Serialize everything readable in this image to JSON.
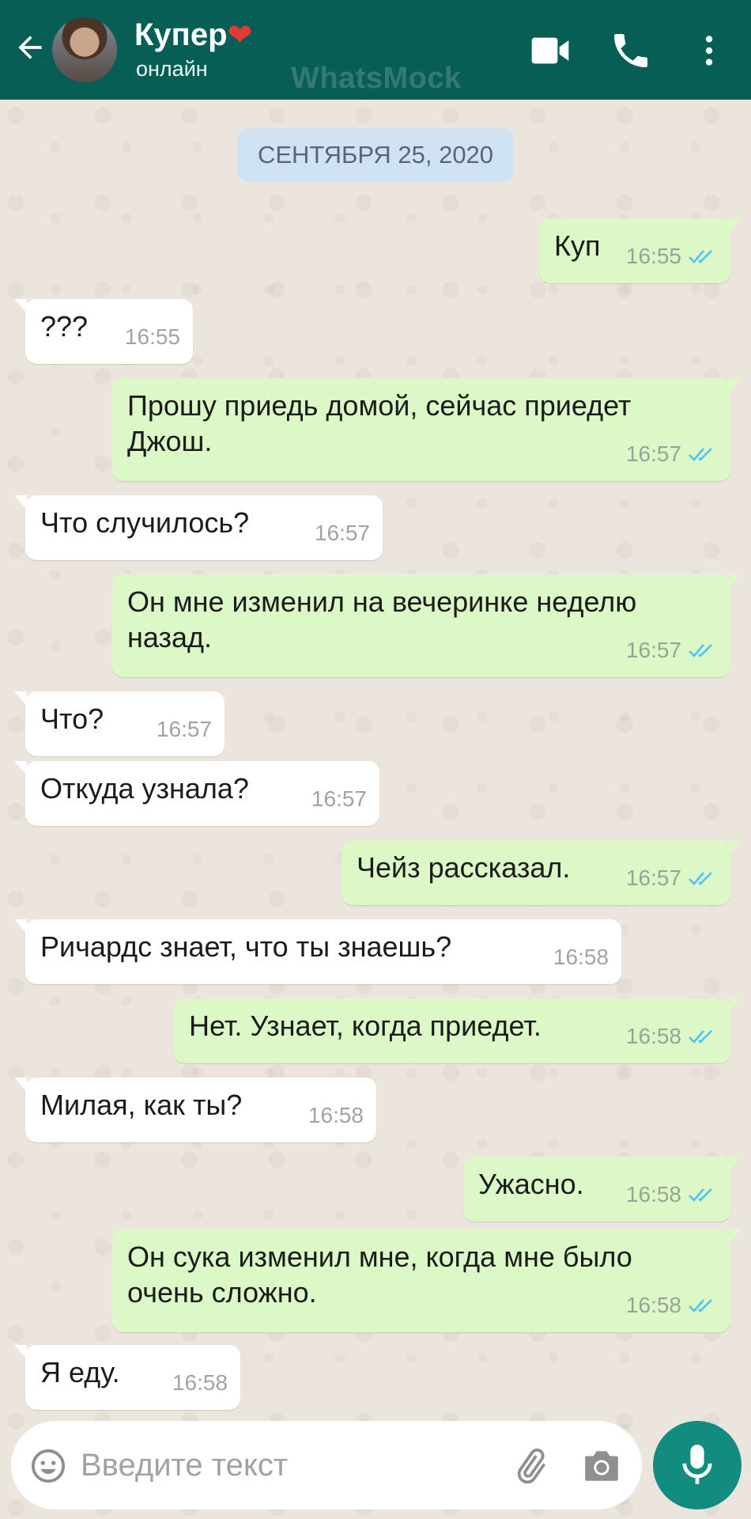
{
  "header": {
    "contact_name": "Купер",
    "contact_status": "онлайн",
    "watermark": "WhatsMock",
    "heart": "❤",
    "icons": [
      "back-arrow-icon",
      "video-call-icon",
      "phone-icon",
      "more-vertical-icon"
    ]
  },
  "chat": {
    "date": "СЕНТЯБРЯ 25, 2020",
    "messages": [
      {
        "dir": "out",
        "text": "Куп",
        "time": "16:55"
      },
      {
        "dir": "in",
        "text": "???",
        "time": "16:55"
      },
      {
        "dir": "out",
        "text": "Прошу приедь домой, сейчас приедет Джош.",
        "time": "16:57"
      },
      {
        "dir": "in",
        "text": "Что случилось?",
        "time": "16:57"
      },
      {
        "dir": "out",
        "text": "Он мне изменил на вечеринке неделю назад.",
        "time": "16:57"
      },
      {
        "dir": "in",
        "text": "Что?",
        "time": "16:57"
      },
      {
        "dir": "in",
        "text": "Откуда узнала?",
        "time": "16:57"
      },
      {
        "dir": "out",
        "text": "Чейз рассказал.",
        "time": "16:57"
      },
      {
        "dir": "in",
        "text": "Ричардс знает, что ты знаешь?",
        "time": "16:58"
      },
      {
        "dir": "out",
        "text": "Нет. Узнает, когда приедет.",
        "time": "16:58"
      },
      {
        "dir": "in",
        "text": "Милая, как ты?",
        "time": "16:58"
      },
      {
        "dir": "out",
        "text": "Ужасно.",
        "time": "16:58"
      },
      {
        "dir": "out",
        "text": "Он сука изменил мне, когда мне было очень сложно.",
        "time": "16:58"
      },
      {
        "dir": "in",
        "text": "Я еду.",
        "time": "16:58"
      }
    ]
  },
  "input": {
    "placeholder": "Введите текст",
    "icons": [
      "emoji-icon",
      "attach-icon",
      "camera-icon",
      "mic-icon"
    ]
  },
  "colors": {
    "header": "#075e54",
    "outgoing_bubble": "#dcf8c6",
    "incoming_bubble": "#ffffff",
    "read_ticks": "#4fc3f7",
    "mic_button": "#128c7e",
    "date_chip": "#cfe3f3"
  }
}
